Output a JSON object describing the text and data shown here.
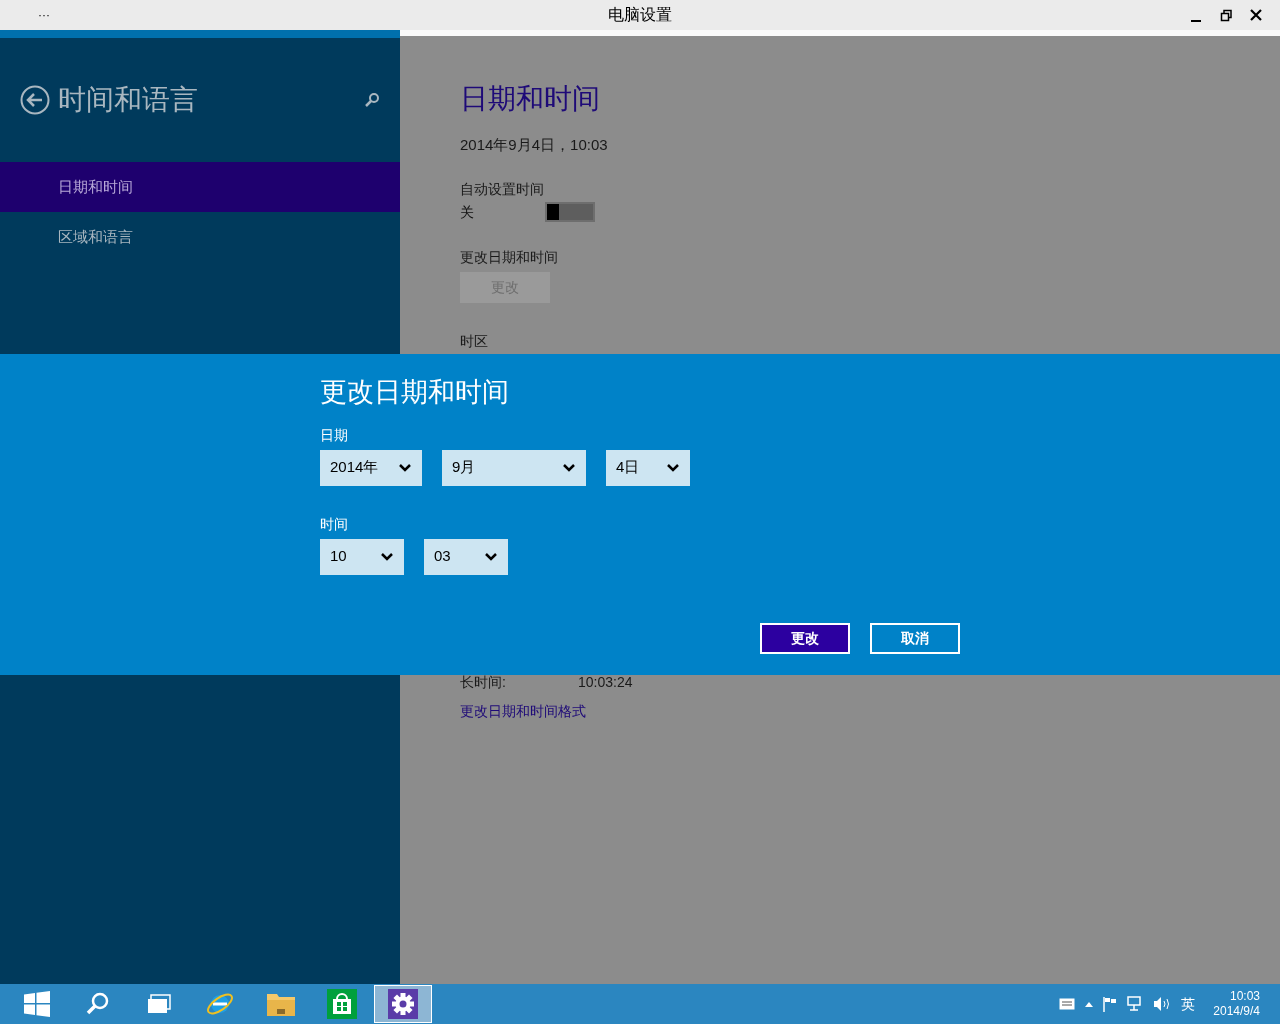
{
  "window": {
    "title": "电脑设置",
    "menu_glyph": "···"
  },
  "sidebar": {
    "title": "时间和语言",
    "items": [
      {
        "label": "日期和时间",
        "selected": true
      },
      {
        "label": "区域和语言",
        "selected": false
      }
    ]
  },
  "content": {
    "heading": "日期和时间",
    "current": "2014年9月4日，10:03",
    "auto_time": {
      "label": "自动设置时间",
      "value": "关",
      "on": false
    },
    "change": {
      "label": "更改日期和时间",
      "button": "更改",
      "disabled": true
    },
    "timezone": {
      "label": "时区"
    },
    "long_time": {
      "label": "长时间:",
      "value": "10:03:24"
    },
    "format_link": "更改日期和时间格式"
  },
  "dialog": {
    "title": "更改日期和时间",
    "date_label": "日期",
    "date": [
      {
        "value": "2014年"
      },
      {
        "value": "9月"
      },
      {
        "value": "4日"
      }
    ],
    "time_label": "时间",
    "time": [
      {
        "value": "10"
      },
      {
        "value": "03"
      }
    ],
    "buttons": [
      {
        "label": "更改",
        "primary": true
      },
      {
        "label": "取消",
        "primary": false
      }
    ]
  },
  "taskbar": {
    "apps": [
      {
        "kind": "start",
        "selected": false
      },
      {
        "kind": "search",
        "selected": false
      },
      {
        "kind": "taskview",
        "selected": false
      },
      {
        "kind": "browser",
        "selected": false
      },
      {
        "kind": "explorer",
        "selected": false
      },
      {
        "kind": "store",
        "selected": false
      },
      {
        "kind": "settings",
        "selected": true
      }
    ],
    "ime": "英",
    "time": "10:03",
    "date": "2014/9/4"
  }
}
